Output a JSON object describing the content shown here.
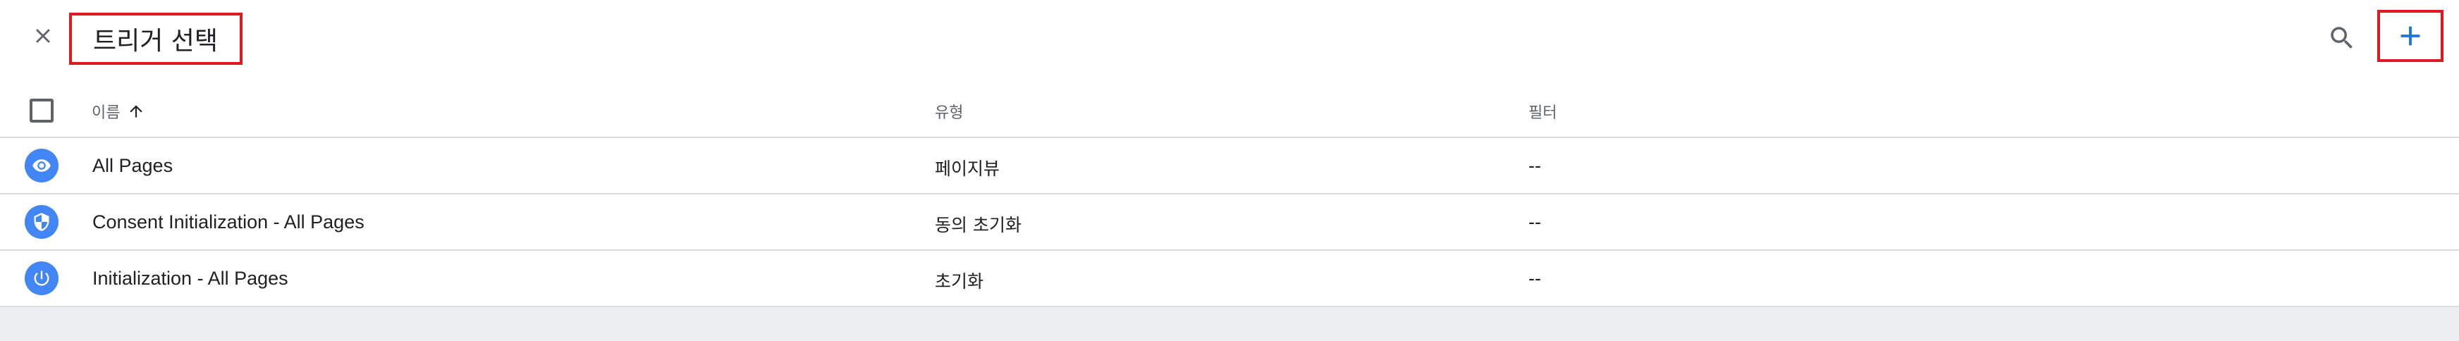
{
  "header": {
    "title": "트리거 선택"
  },
  "icons": {
    "close": "close-icon",
    "search": "search-icon",
    "add": "plus-icon",
    "sort": "arrow-up-icon",
    "page_view": "eye-icon",
    "consent": "shield-icon",
    "initialization": "power-icon"
  },
  "colors": {
    "accent": "#1a73e8",
    "icon_bg": "#4285f4",
    "highlight_border": "#e0181f"
  },
  "table": {
    "columns": {
      "name": "이름",
      "type": "유형",
      "filter": "필터"
    },
    "sort": {
      "column": "name",
      "direction": "ascending"
    },
    "rows": [
      {
        "name": "All Pages",
        "type": "페이지뷰",
        "filter": "--",
        "icon": "eye-icon"
      },
      {
        "name": "Consent Initialization - All Pages",
        "type": "동의 초기화",
        "filter": "--",
        "icon": "shield-icon"
      },
      {
        "name": "Initialization - All Pages",
        "type": "초기화",
        "filter": "--",
        "icon": "power-icon"
      }
    ]
  }
}
